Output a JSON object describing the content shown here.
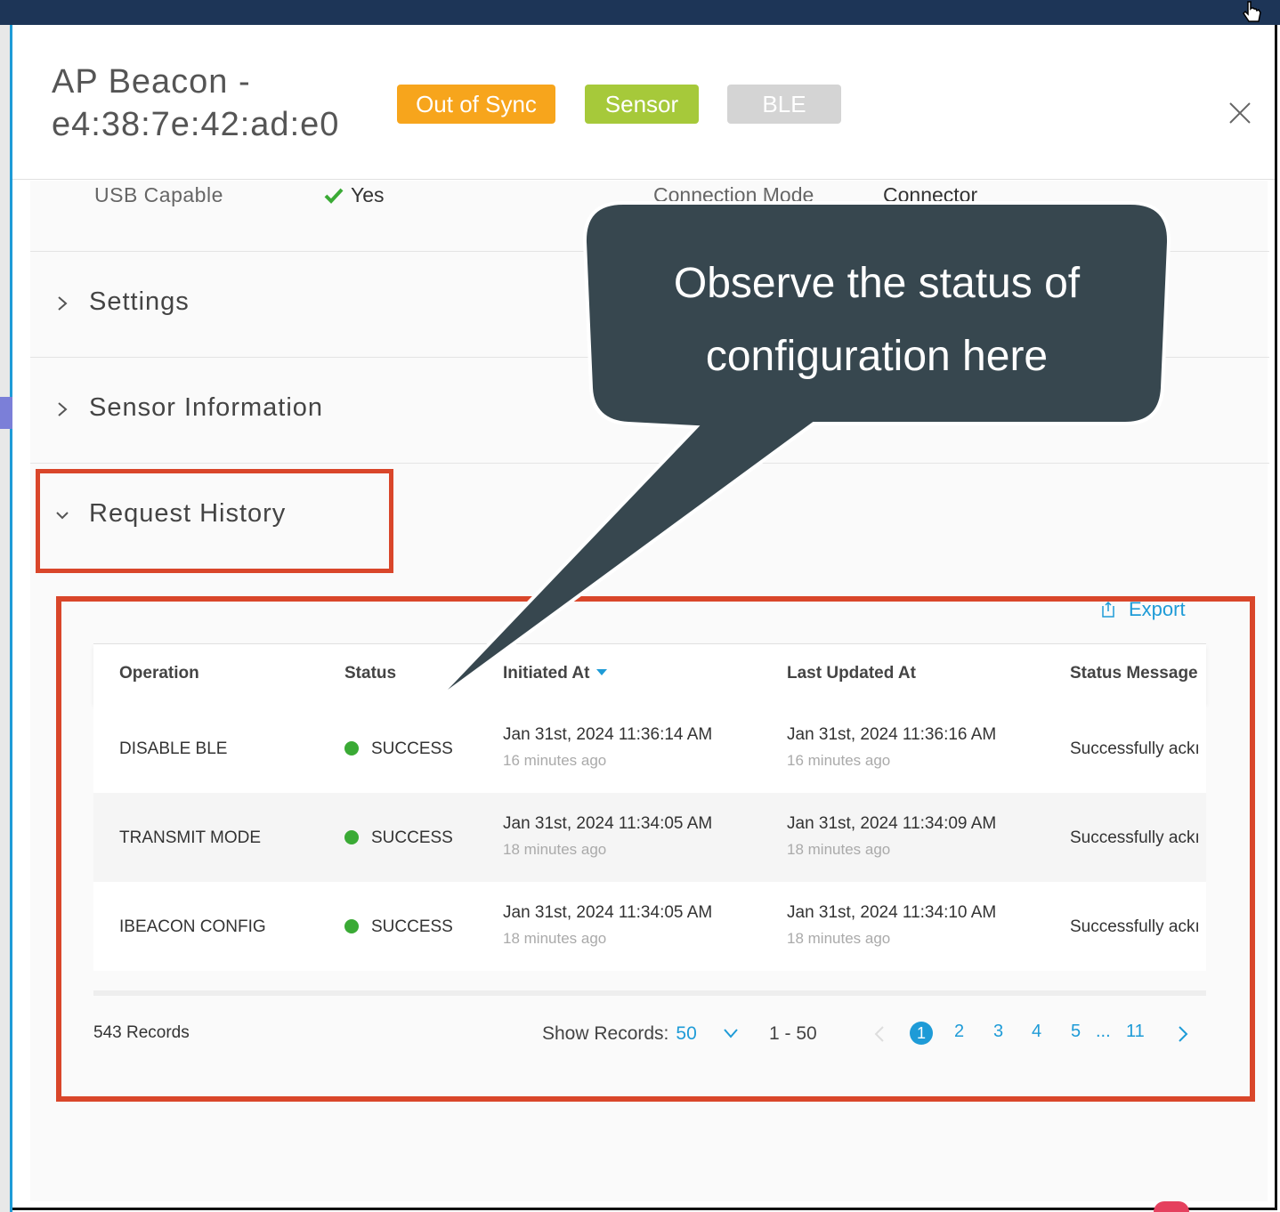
{
  "header": {
    "title": "AP Beacon - e4:38:7e:42:ad:e0",
    "badges": {
      "out_of_sync": "Out of Sync",
      "sensor": "Sensor",
      "ble": "BLE"
    }
  },
  "details": {
    "usb_label": "USB Capable",
    "usb_value": "Yes",
    "connection_label": "Connection Mode",
    "connection_value": "Connector"
  },
  "sections": {
    "settings": "Settings",
    "sensor_info": "Sensor Information",
    "request_history": "Request History"
  },
  "callout": {
    "line1": "Observe the status of",
    "line2": "configuration here"
  },
  "table": {
    "export_label": "Export",
    "columns": {
      "operation": "Operation",
      "status": "Status",
      "initiated": "Initiated At",
      "updated": "Last Updated At",
      "message": "Status Message"
    },
    "rows": [
      {
        "operation": "DISABLE BLE",
        "status": "SUCCESS",
        "initiated": "Jan 31st, 2024 11:36:14 AM",
        "initiated_ago": "16 minutes ago",
        "updated": "Jan 31st, 2024 11:36:16 AM",
        "updated_ago": "16 minutes ago",
        "message": "Successfully ackı"
      },
      {
        "operation": "TRANSMIT MODE",
        "status": "SUCCESS",
        "initiated": "Jan 31st, 2024 11:34:05 AM",
        "initiated_ago": "18 minutes ago",
        "updated": "Jan 31st, 2024 11:34:09 AM",
        "updated_ago": "18 minutes ago",
        "message": "Successfully ackı"
      },
      {
        "operation": "IBEACON CONFIG",
        "status": "SUCCESS",
        "initiated": "Jan 31st, 2024 11:34:05 AM",
        "initiated_ago": "18 minutes ago",
        "updated": "Jan 31st, 2024 11:34:10 AM",
        "updated_ago": "18 minutes ago",
        "message": "Successfully ackı"
      }
    ]
  },
  "footer": {
    "records": "543 Records",
    "show_records_label": "Show Records:",
    "show_records_value": "50",
    "range": "1 - 50",
    "pages": [
      "1",
      "2",
      "3",
      "4",
      "5",
      "...",
      "11"
    ]
  },
  "colors": {
    "accent": "#1e9bd7",
    "out_of_sync": "#f7a51c",
    "sensor": "#a6c93a",
    "ble": "#d4d4d4",
    "success": "#3aaa35",
    "highlight": "#d9462a",
    "callout": "#37474f"
  }
}
